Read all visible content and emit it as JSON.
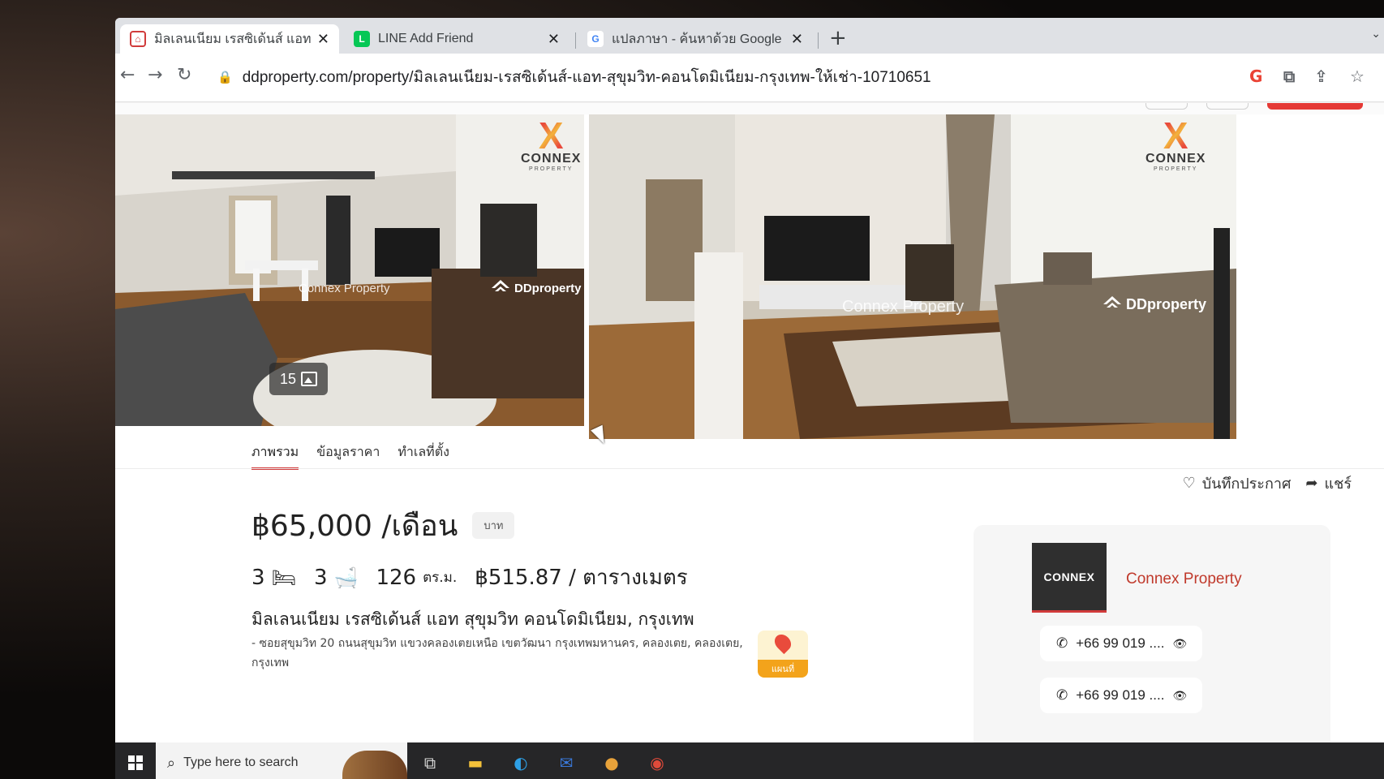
{
  "browser": {
    "tabs": [
      {
        "title": "มิลเลนเนียม เรสซิเด้นส์ แอท สุขุมวิท คอ",
        "favicon": "ddproperty-icon",
        "active": true
      },
      {
        "title": "LINE Add Friend",
        "favicon": "line-icon",
        "active": false
      },
      {
        "title": "แปลภาษา - ค้นหาด้วย Google",
        "favicon": "google-icon",
        "active": false
      }
    ],
    "url": "ddproperty.com/property/มิลเลนเนียม-เรสซิเด้นส์-แอท-สุขุมวิท-คอนโดมิเนียม-กรุงเทพ-ให้เช่า-10710651"
  },
  "gallery": {
    "photo_count": "15",
    "watermark_text": "Connex Property",
    "dd_watermark": "DDproperty",
    "logo_word": "CONNEX",
    "logo_sub": "PROPERTY"
  },
  "detail_tabs": [
    "ภาพรวม",
    "ข้อมูลราคา",
    "ทำเลที่ตั้ง"
  ],
  "actions": {
    "save": "บันทึกประกาศ",
    "share": "แชร์"
  },
  "listing": {
    "price": "฿65,000 /เดือน",
    "currency_unit": "บาท",
    "bedrooms": "3",
    "bathrooms": "3",
    "area": "126",
    "area_unit": "ตร.ม.",
    "price_per_sqm": "฿515.87 / ตารางเมตร",
    "title": "มิลเลนเนียม เรสซิเด้นส์ แอท สุขุมวิท คอนโดมิเนียม, กรุงเทพ",
    "address": "- ซอยสุขุมวิท 20 ถนนสุขุมวิท แขวงคลองเตยเหนือ เขตวัฒนา กรุงเทพมหานคร, คลองเตย, คลองเตย, กรุงเทพ",
    "map_label": "แผนที่"
  },
  "agent": {
    "name": "Connex Property",
    "logo_text": "CONNEX",
    "phones": [
      "+66 99 019 ....",
      "+66 99 019 ...."
    ]
  },
  "taskbar": {
    "search_placeholder": "Type here to search"
  },
  "colors": {
    "accent": "#d13b3b",
    "agent_name": "#c0392b"
  }
}
